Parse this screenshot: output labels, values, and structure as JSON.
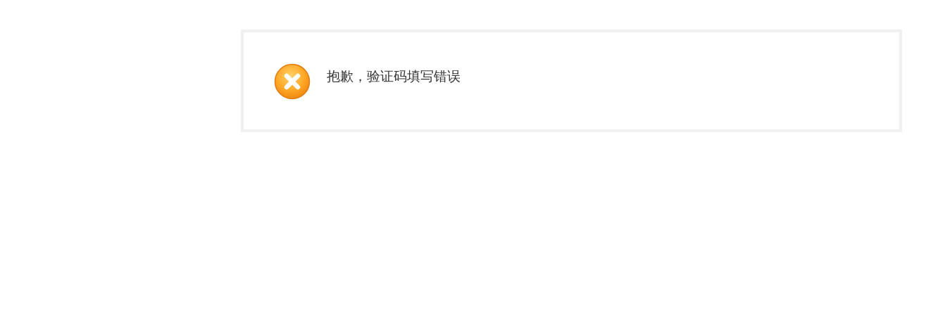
{
  "message": {
    "kind": "error",
    "text": "抱歉，验证码填写错误"
  }
}
